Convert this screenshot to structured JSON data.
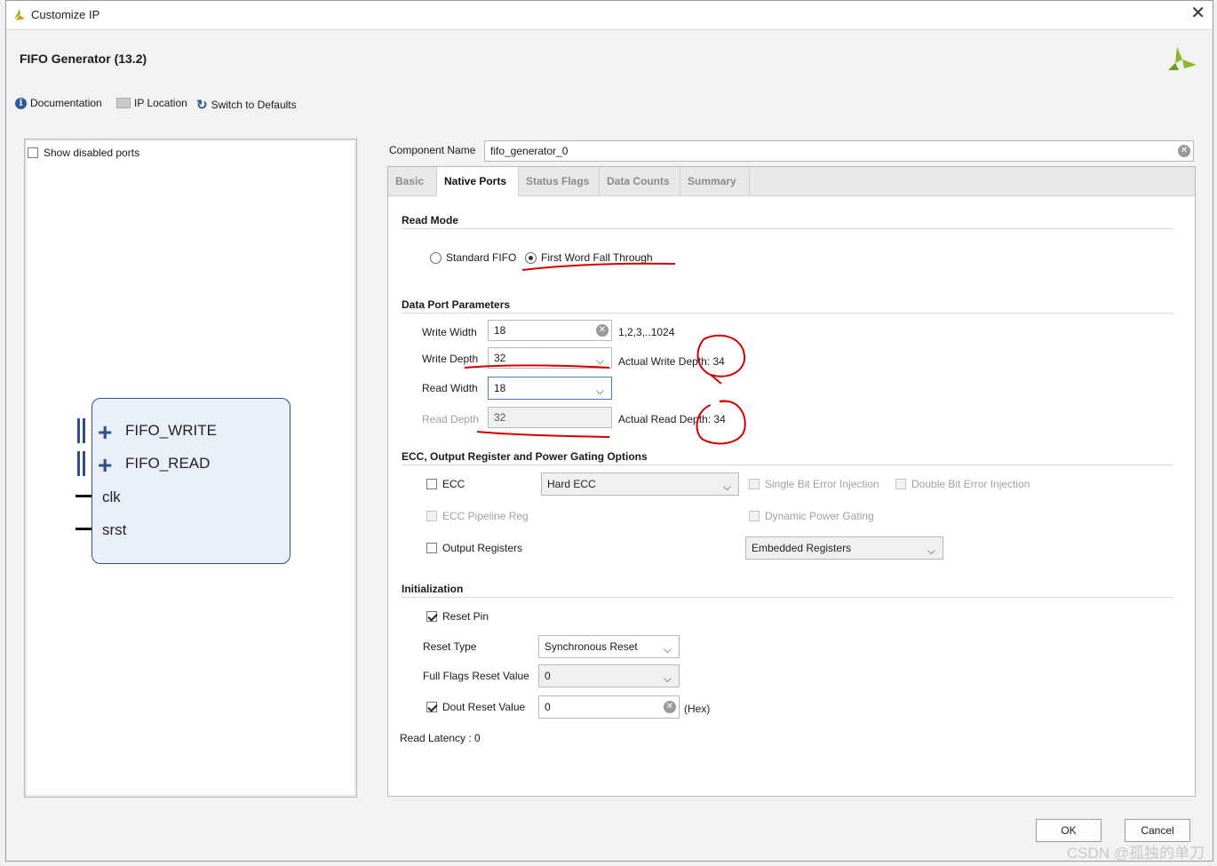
{
  "window": {
    "title": "Customize IP",
    "header": "FIFO Generator (13.2)"
  },
  "toolbar": {
    "documentation": "Documentation",
    "ip_location": "IP Location",
    "switch_defaults": "Switch to Defaults"
  },
  "left_panel": {
    "show_disabled_ports": "Show disabled ports",
    "ports": [
      "FIFO_WRITE",
      "FIFO_READ",
      "clk",
      "srst"
    ]
  },
  "component": {
    "label": "Component Name",
    "value": "fifo_generator_0"
  },
  "tabs": [
    "Basic",
    "Native Ports",
    "Status Flags",
    "Data Counts",
    "Summary"
  ],
  "read_mode": {
    "title": "Read Mode",
    "standard": "Standard FIFO",
    "fwft": "First Word Fall Through"
  },
  "data_port": {
    "title": "Data Port Parameters",
    "write_width_label": "Write Width",
    "write_width": "18",
    "write_width_hint": "1,2,3,..1024",
    "write_depth_label": "Write Depth",
    "write_depth": "32",
    "actual_write_depth": "Actual Write Depth: 34",
    "read_width_label": "Read Width",
    "read_width": "18",
    "read_depth_label": "Read Depth",
    "read_depth": "32",
    "actual_read_depth": "Actual Read Depth: 34"
  },
  "ecc": {
    "title": "ECC, Output Register and Power Gating Options",
    "ecc_label": "ECC",
    "ecc_select": "Hard ECC",
    "single_bit": "Single Bit Error Injection",
    "double_bit": "Double Bit Error Injection",
    "pipeline": "ECC Pipeline Reg",
    "dynamic_power": "Dynamic Power Gating",
    "output_registers": "Output Registers",
    "output_select": "Embedded Registers"
  },
  "init": {
    "title": "Initialization",
    "reset_pin": "Reset Pin",
    "reset_type_label": "Reset Type",
    "reset_type": "Synchronous Reset",
    "full_flags_label": "Full Flags Reset Value",
    "full_flags": "0",
    "dout_reset_label": "Dout Reset Value",
    "dout_reset": "0",
    "hex": "(Hex)",
    "read_latency": "Read Latency : 0"
  },
  "buttons": {
    "ok": "OK",
    "cancel": "Cancel"
  },
  "watermark": "CSDN @孤独的单刀",
  "colors": {
    "accent": "#2e4f87",
    "annotation": "#d40000"
  }
}
